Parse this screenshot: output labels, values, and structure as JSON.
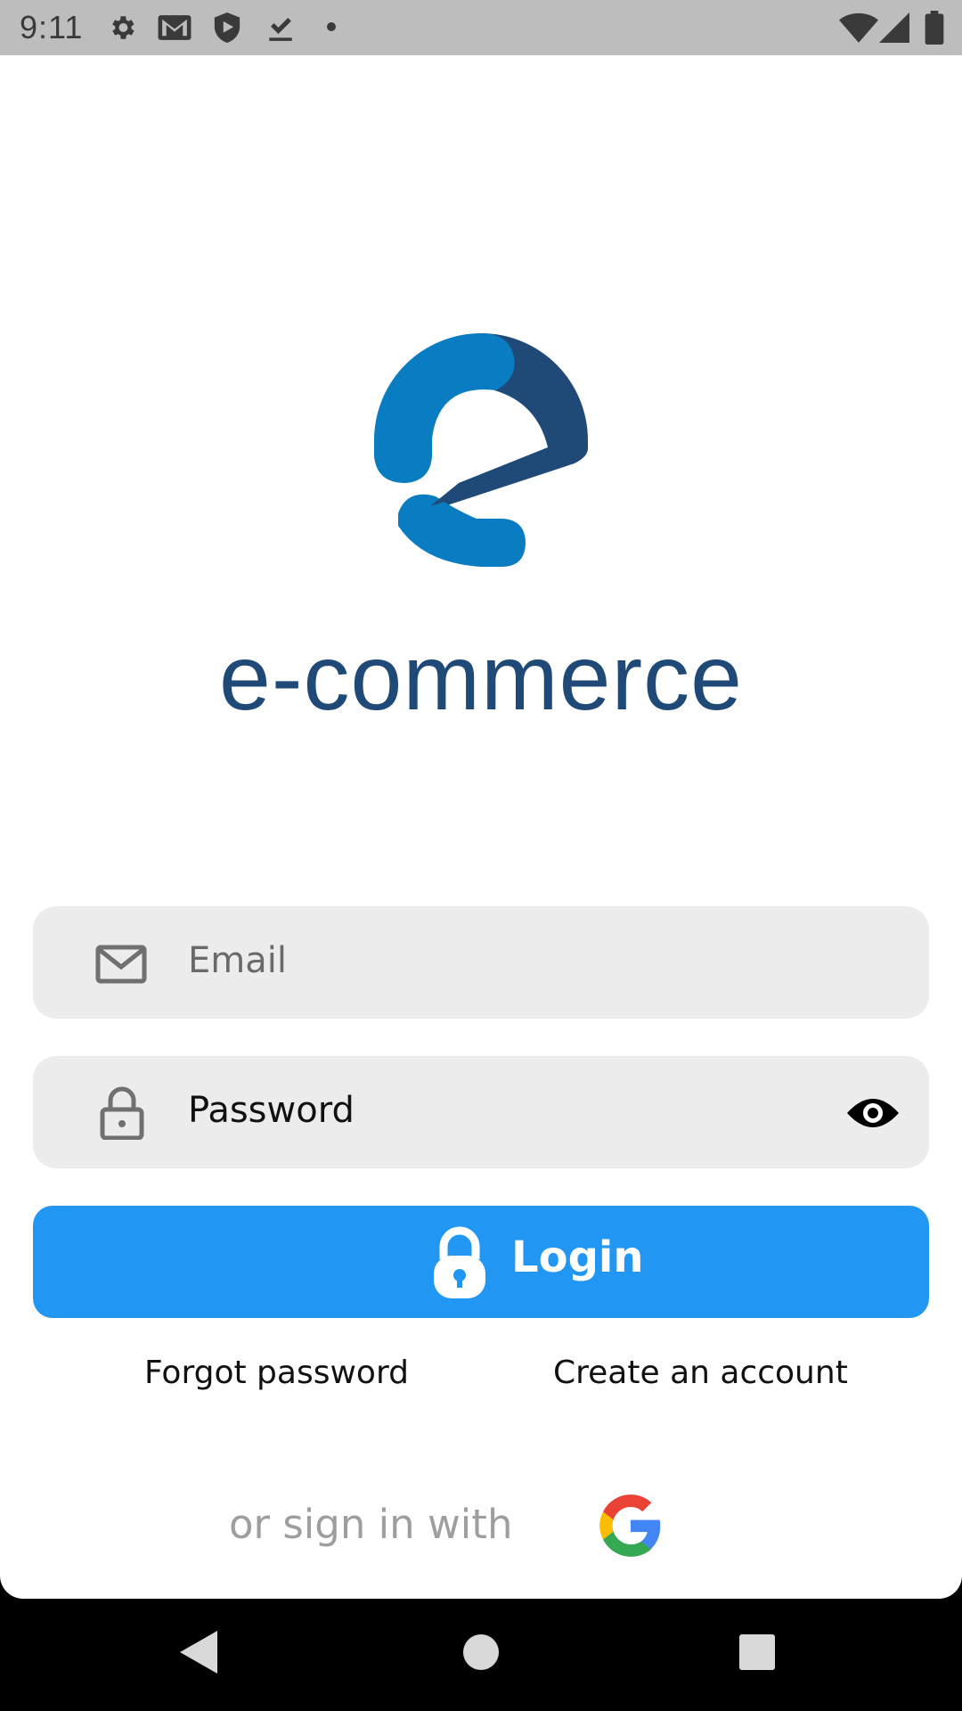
{
  "status_bar": {
    "time": "9:11",
    "left_icons": [
      "gear-icon",
      "gmail-icon",
      "shield-play-icon",
      "download-done-icon",
      "dot-icon"
    ],
    "right_icons": [
      "wifi-icon",
      "signal-icon",
      "battery-icon"
    ]
  },
  "brand": {
    "name": "e-commerce",
    "primary_color": "#1f4a78",
    "accent_color": "#0a7dc2"
  },
  "form": {
    "email": {
      "placeholder": "Email",
      "value": "",
      "icon": "mail-icon"
    },
    "password": {
      "placeholder": "Password",
      "value": "",
      "icon": "lock-icon",
      "toggle_icon": "eye-icon"
    },
    "login_button": {
      "label": "Login",
      "icon": "lock-icon",
      "color": "#2196f3"
    },
    "forgot_password": "Forgot password",
    "create_account": "Create an account",
    "alternate_signin": {
      "label": "or sign in with",
      "provider_icon": "google-icon"
    }
  },
  "nav_bar": {
    "buttons": [
      "back-icon",
      "home-icon",
      "recents-icon"
    ]
  }
}
